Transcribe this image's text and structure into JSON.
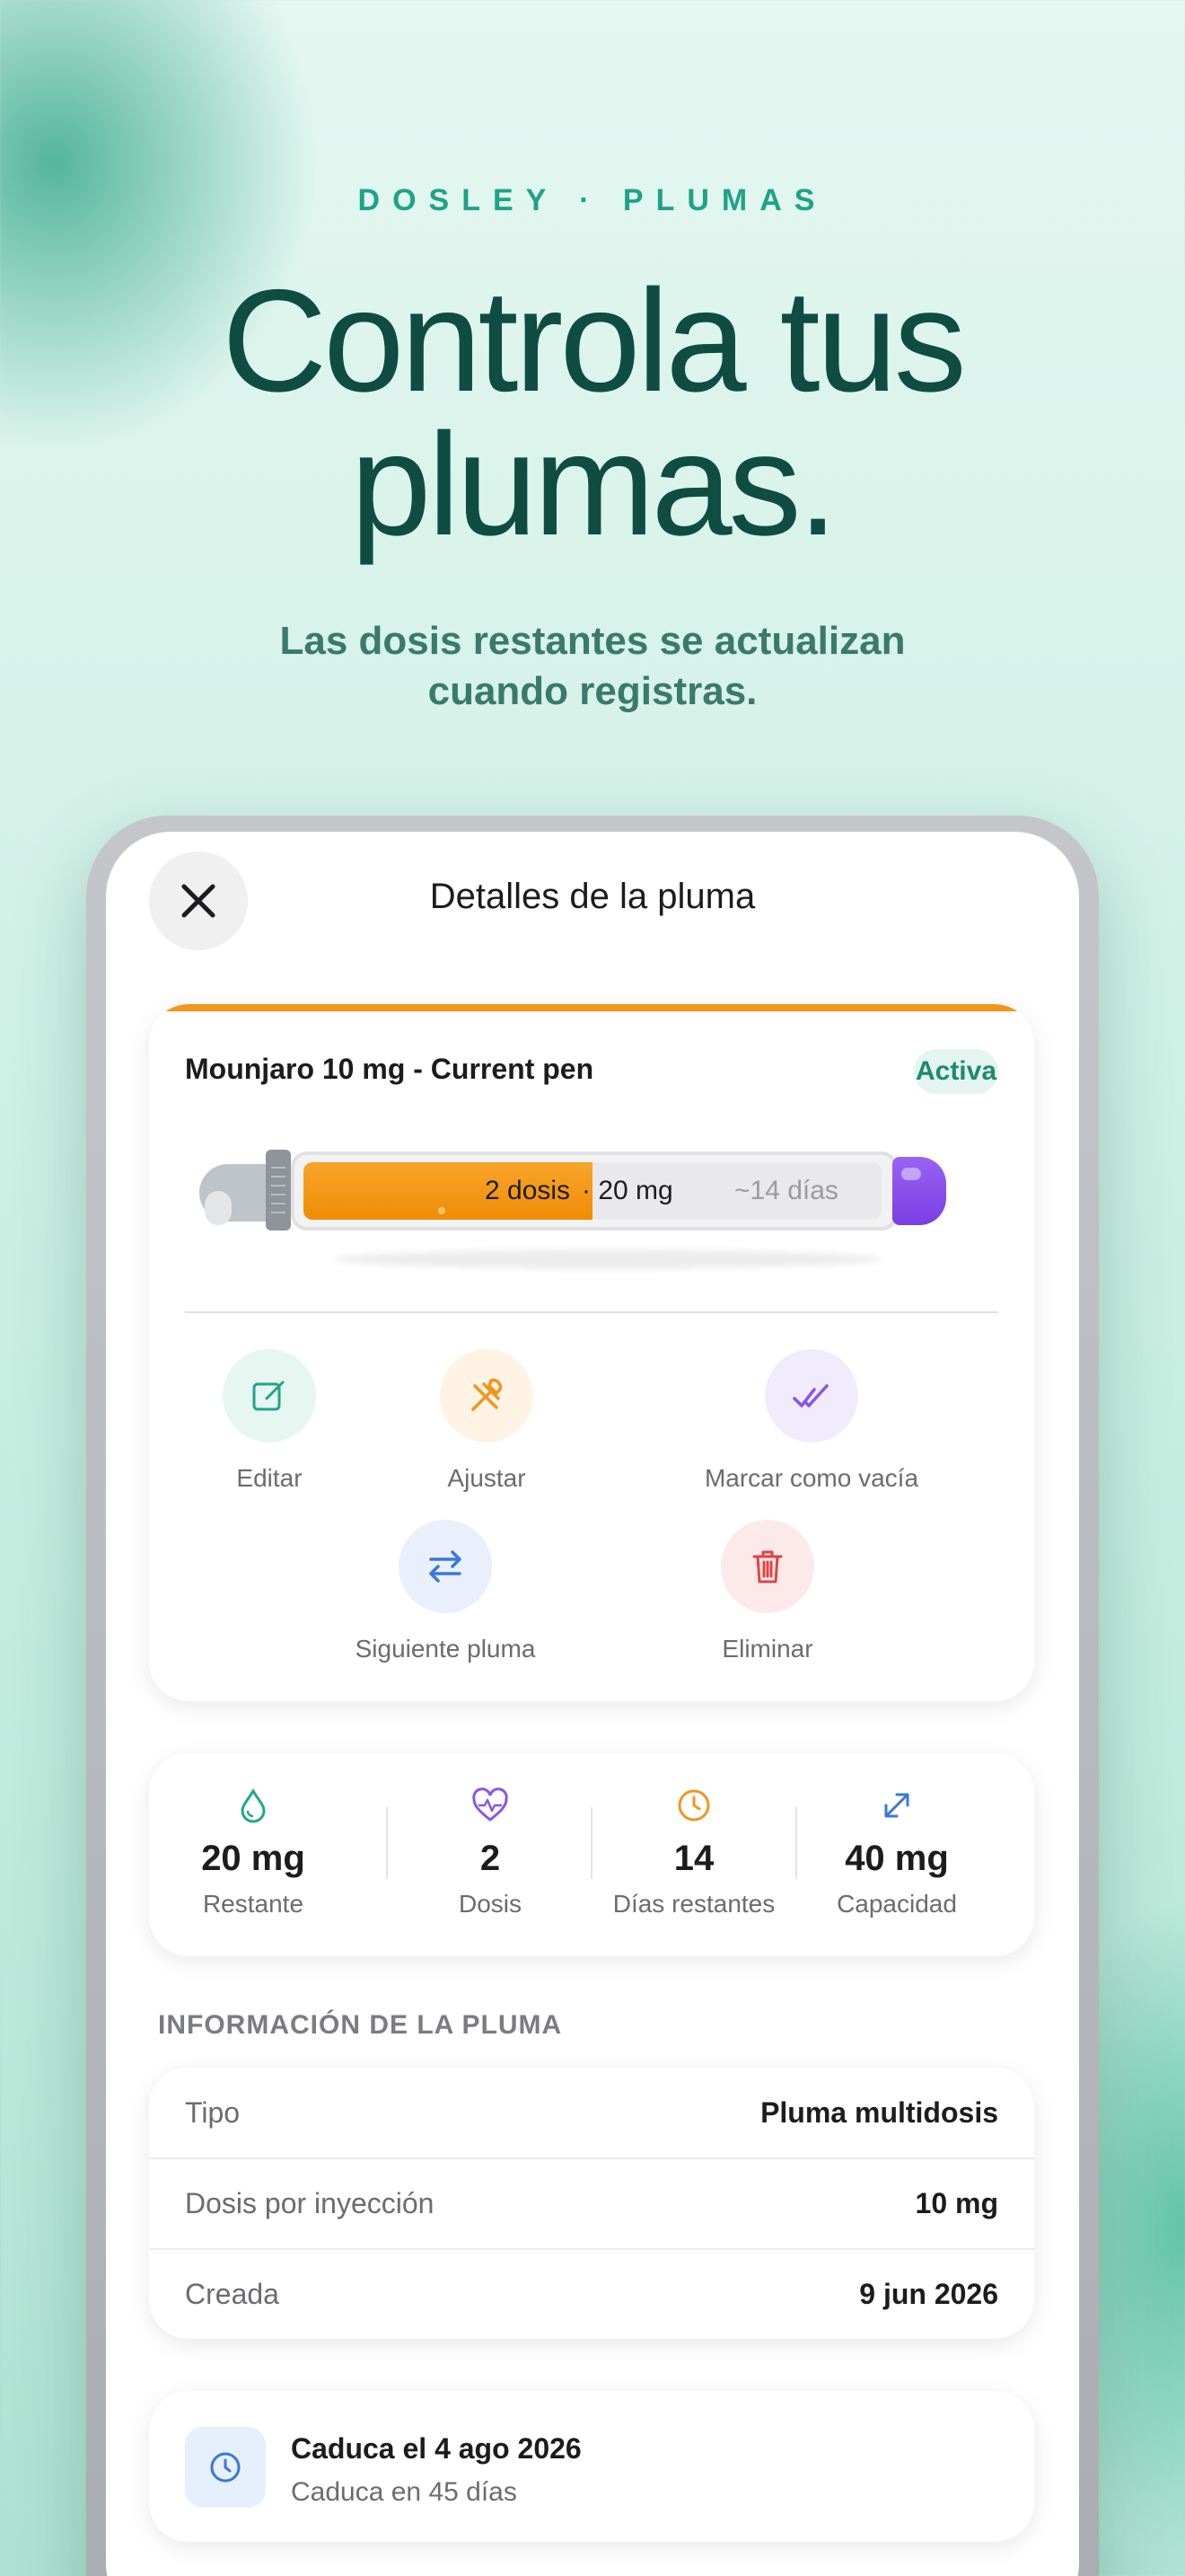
{
  "hero": {
    "eyebrow": "DOSLEY · PLUMAS",
    "headline_line1": "Controla tus",
    "headline_line2": "plumas.",
    "subhead_line1": "Las dosis restantes se actualizan",
    "subhead_line2": "cuando registras."
  },
  "sheet": {
    "title": "Detalles de la pluma",
    "close_icon": "close-icon"
  },
  "pen": {
    "name": "Mounjaro 10 mg - Current pen",
    "status": "Activa",
    "fill_fraction": 0.5,
    "doses_label": "2 dosis",
    "mg_label": "· 20 mg",
    "days_label": "~14 días",
    "colors": {
      "fill": "#f2961c",
      "knob": "#8b50ee",
      "status": "#1e8a6f"
    }
  },
  "actions": {
    "edit": {
      "label": "Editar",
      "icon": "edit-icon"
    },
    "adjust": {
      "label": "Ajustar",
      "icon": "tools-icon"
    },
    "mark_empty": {
      "label": "Marcar como vacía",
      "icon": "double-check-icon"
    },
    "next_pen": {
      "label": "Siguiente pluma",
      "icon": "swap-arrows-icon"
    },
    "delete": {
      "label": "Eliminar",
      "icon": "trash-icon"
    }
  },
  "stats": [
    {
      "value": "20 mg",
      "label": "Restante",
      "icon": "droplet-icon"
    },
    {
      "value": "2",
      "label": "Dosis",
      "icon": "heart-pulse-icon"
    },
    {
      "value": "14",
      "label": "Días restantes",
      "icon": "clock-icon"
    },
    {
      "value": "40 mg",
      "label": "Capacidad",
      "icon": "expand-arrows-icon"
    }
  ],
  "info": {
    "section_title": "INFORMACIÓN DE LA PLUMA",
    "rows": [
      {
        "key": "Tipo",
        "value": "Pluma multidosis"
      },
      {
        "key": "Dosis por inyección",
        "value": "10 mg"
      },
      {
        "key": "Creada",
        "value": "9 jun 2026"
      }
    ]
  },
  "expiry": {
    "title": "Caduca el 4 ago 2026",
    "subtitle": "Caduca en 45 días",
    "icon": "clock-icon"
  }
}
